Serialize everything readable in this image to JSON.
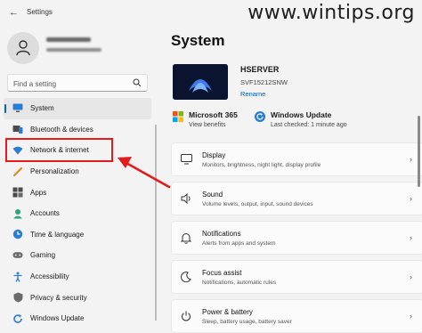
{
  "titlebar": {
    "back_glyph": "←",
    "app_title": "Settings",
    "watermark": "www.wintips.org"
  },
  "search": {
    "placeholder": "Find a setting"
  },
  "nav": {
    "items": [
      {
        "label": "System",
        "icon": "monitor-icon"
      },
      {
        "label": "Bluetooth & devices",
        "icon": "bluetooth-devices-icon"
      },
      {
        "label": "Network & internet",
        "icon": "wifi-icon"
      },
      {
        "label": "Personalization",
        "icon": "brush-icon"
      },
      {
        "label": "Apps",
        "icon": "apps-icon"
      },
      {
        "label": "Accounts",
        "icon": "account-icon"
      },
      {
        "label": "Time & language",
        "icon": "globe-clock-icon"
      },
      {
        "label": "Gaming",
        "icon": "gamepad-icon"
      },
      {
        "label": "Accessibility",
        "icon": "accessibility-icon"
      },
      {
        "label": "Privacy & security",
        "icon": "shield-icon"
      },
      {
        "label": "Windows Update",
        "icon": "update-icon"
      }
    ]
  },
  "main": {
    "title": "System",
    "device": {
      "name": "HSERVER",
      "model": "SVF15212SNW",
      "rename": "Rename"
    },
    "quick": [
      {
        "title": "Microsoft 365",
        "sub": "View benefits",
        "icon": "microsoft-logo-icon"
      },
      {
        "title": "Windows Update",
        "sub": "Last checked: 1 minute ago",
        "icon": "windows-update-icon"
      }
    ],
    "cards": [
      {
        "title": "Display",
        "sub": "Monitors, brightness, night light, display profile",
        "icon": "display-icon"
      },
      {
        "title": "Sound",
        "sub": "Volume levels, output, input, sound devices",
        "icon": "speaker-icon"
      },
      {
        "title": "Notifications",
        "sub": "Alerts from apps and system",
        "icon": "bell-icon"
      },
      {
        "title": "Focus assist",
        "sub": "Notifications, automatic rules",
        "icon": "moon-icon"
      },
      {
        "title": "Power & battery",
        "sub": "Sleep, battery usage, battery saver",
        "icon": "power-icon"
      }
    ],
    "chevron": "›"
  },
  "colors": {
    "accent": "#0067c0",
    "annotation": "#e21b1b"
  }
}
